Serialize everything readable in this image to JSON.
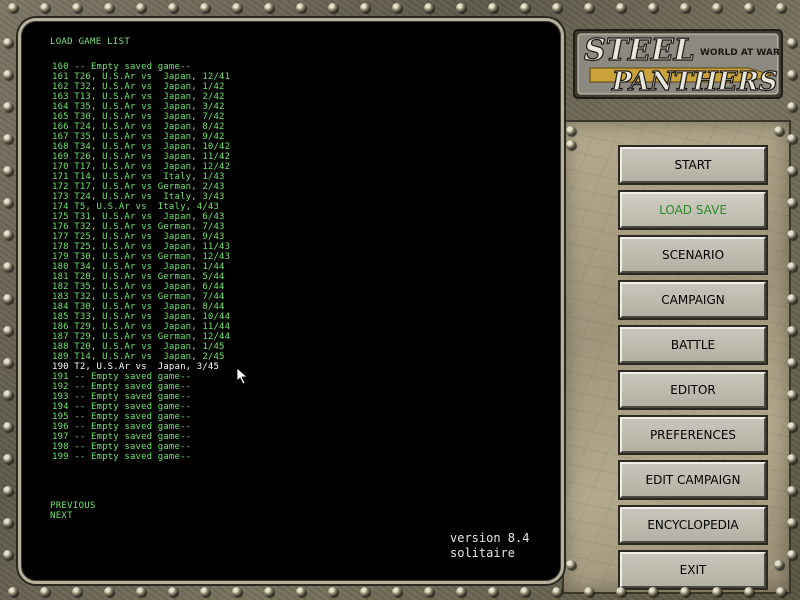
{
  "list": {
    "title": "LOAD GAME LIST",
    "items": [
      "160 -- Empty saved game--",
      "161 T26, U.S.Ar vs  Japan, 12/41",
      "162 T32, U.S.Ar vs  Japan, 1/42",
      "163 T13, U.S.Ar vs  Japan, 2/42",
      "164 T35, U.S.Ar vs  Japan, 3/42",
      "165 T30, U.S.Ar vs  Japan, 7/42",
      "166 T24, U.S.Ar vs  Japan, 8/42",
      "167 T35, U.S.Ar vs  Japan, 9/42",
      "168 T34, U.S.Ar vs  Japan, 10/42",
      "169 T26, U.S.Ar vs  Japan, 11/42",
      "170 T17, U.S.Ar vs  Japan, 12/42",
      "171 T14, U.S.Ar vs  Italy, 1/43",
      "172 T17, U.S.Ar vs German, 2/43",
      "173 T24, U.S.Ar vs  Italy, 3/43",
      "174 T5, U.S.Ar vs  Italy, 4/43",
      "175 T31, U.S.Ar vs  Japan, 6/43",
      "176 T32, U.S.Ar vs German, 7/43",
      "177 T25, U.S.Ar vs  Japan, 9/43",
      "178 T25, U.S.Ar vs  Japan, 11/43",
      "179 T30, U.S.Ar vs German, 12/43",
      "180 T34, U.S.Ar vs  Japan, 1/44",
      "181 T20, U.S.Ar vs German, 5/44",
      "182 T35, U.S.Ar vs  Japan, 6/44",
      "183 T32, U.S.Ar vs German, 7/44",
      "184 T30, U.S.Ar vs  Japan, 8/44",
      "185 T33, U.S.Ar vs  Japan, 10/44",
      "186 T29, U.S.Ar vs  Japan, 11/44",
      "187 T29, U.S.Ar vs German, 12/44",
      "188 T20, U.S.Ar vs  Japan, 1/45",
      "189 T14, U.S.Ar vs  Japan, 2/45",
      "190 T2, U.S.Ar vs  Japan, 3/45",
      "191 -- Empty saved game--",
      "192 -- Empty saved game--",
      "193 -- Empty saved game--",
      "194 -- Empty saved game--",
      "195 -- Empty saved game--",
      "196 -- Empty saved game--",
      "197 -- Empty saved game--",
      "198 -- Empty saved game--",
      "199 -- Empty saved game--"
    ],
    "selected_index": 30,
    "previous_label": "PREVIOUS",
    "next_label": "NEXT"
  },
  "version": {
    "line1": "version 8.4",
    "line2": "solitaire"
  },
  "logo": {
    "steel": "STEEL",
    "panthers": "PANTHERS",
    "subtitle": "WORLD AT WAR"
  },
  "menu": {
    "start": "START",
    "load_save": "LOAD SAVE",
    "scenario": "SCENARIO",
    "campaign": "CAMPAIGN",
    "battle": "BATTLE",
    "editor": "EDITOR",
    "preferences": "PREFERENCES",
    "edit_campaign": "EDIT CAMPAIGN",
    "encyclopedia": "ENCYCLOPEDIA",
    "exit": "EXIT"
  },
  "colors": {
    "list_text": "#6fe26f",
    "selected_text": "#ffffff",
    "active_menu_text": "#2a8a2a"
  },
  "icons": {
    "cursor": "mouse-pointer-icon",
    "rivet": "rivet-icon"
  }
}
